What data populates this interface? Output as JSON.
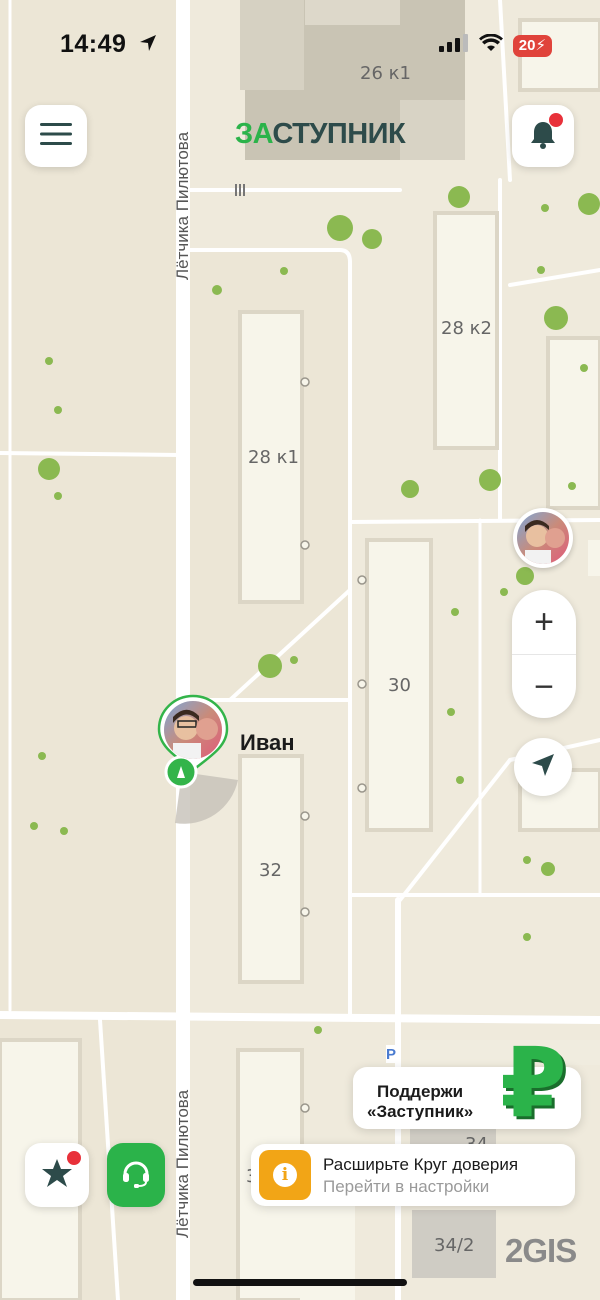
{
  "status_bar": {
    "time": "14:49",
    "battery": "20"
  },
  "app": {
    "logo_part1": "ЗА",
    "logo_part2": "СТУПНИК"
  },
  "map": {
    "buildings": [
      "26 к1",
      "28 к2",
      "28 к1",
      "30",
      "32",
      "34",
      "34/2",
      "3"
    ],
    "street": "Лётчика Пилютова",
    "parking": "P",
    "attribution": "2GIS"
  },
  "person": {
    "name": "Иван"
  },
  "support_card": {
    "line1": "Поддержи",
    "line2": "«Заступник»",
    "symbol": "₽"
  },
  "trust_banner": {
    "title": "Расширьте Круг доверия",
    "subtitle": "Перейти в настройки",
    "icon_symbol": "i"
  },
  "zoom": {
    "plus": "+",
    "minus": "−"
  },
  "colors": {
    "brand_green": "#2bb34a",
    "alert_red": "#e8313a",
    "warning_orange": "#f2a516"
  }
}
